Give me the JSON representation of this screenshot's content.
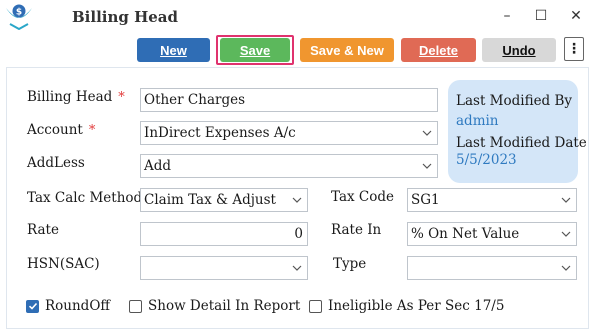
{
  "window": {
    "title": "Billing Head",
    "logo_icon": "app-logo-icon",
    "controls": {
      "minimize": "–",
      "maximize": "☐",
      "close": "✕"
    }
  },
  "toolbar": {
    "new_label": "New",
    "save_label": "Save",
    "save_new_label": "Save & New",
    "delete_label": "Delete",
    "undo_label": "Undo",
    "more_label": "⋮",
    "colors": {
      "new": "#2f6db5",
      "save": "#5cb85c",
      "save_new": "#f0962f",
      "delete": "#e06a55",
      "undo": "#d8d8d8",
      "highlight": "#e0326e"
    }
  },
  "form": {
    "billing_head": {
      "label": "Billing Head",
      "required": "*",
      "value": "Other Charges"
    },
    "account": {
      "label": "Account",
      "required": "*",
      "value": "InDirect Expenses A/c"
    },
    "addless": {
      "label": "AddLess",
      "value": "Add"
    },
    "tax_calc_method": {
      "label": "Tax Calc Method",
      "value": "Claim Tax & Adjust"
    },
    "tax_code": {
      "label": "Tax Code",
      "value": "SG1"
    },
    "rate": {
      "label": "Rate",
      "value": "0"
    },
    "rate_in": {
      "label": "Rate In",
      "value": "% On Net Value"
    },
    "hsn": {
      "label": "HSN(SAC)",
      "value": ""
    },
    "type": {
      "label": "Type",
      "value": ""
    }
  },
  "info": {
    "modified_by_label": "Last Modified By",
    "modified_by_value": "admin",
    "modified_date_label": "Last Modified Date",
    "modified_date_value": "5/5/2023"
  },
  "checkboxes": [
    {
      "label": "RoundOff",
      "checked": true
    },
    {
      "label": "Show Detail In Report",
      "checked": false
    },
    {
      "label": "Ineligible As Per Sec 17/5",
      "checked": false
    }
  ]
}
